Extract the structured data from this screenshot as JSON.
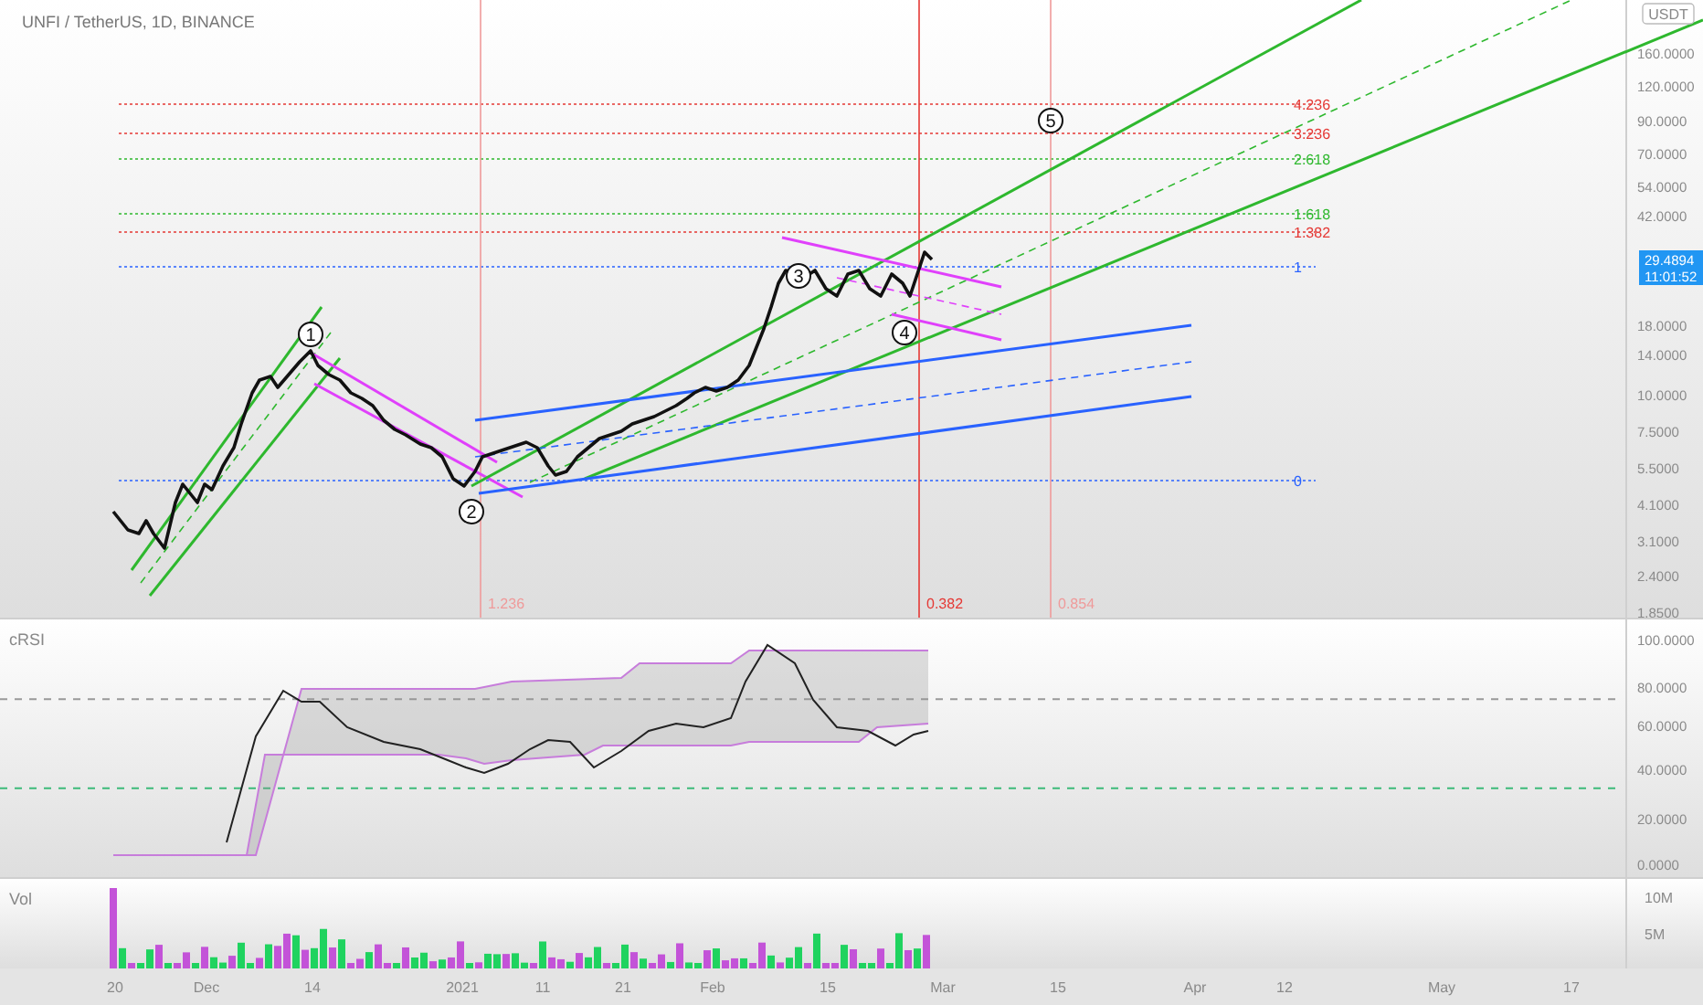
{
  "header": {
    "symbol": "UNFI / TetherUS, 1D, BINANCE"
  },
  "price_pane": {
    "fib_levels": [
      {
        "label": "4.236",
        "color": "#e53935"
      },
      {
        "label": "3.236",
        "color": "#e53935"
      },
      {
        "label": "2.618",
        "color": "#2eb82e"
      },
      {
        "label": "1.618",
        "color": "#2eb82e"
      },
      {
        "label": "1.382",
        "color": "#e53935"
      },
      {
        "label": "1",
        "color": "#2962ff"
      },
      {
        "label": "0",
        "color": "#2962ff"
      }
    ],
    "wave_labels": [
      "1",
      "2",
      "3",
      "4",
      "5"
    ],
    "time_fib_labels": [
      {
        "label": "1.236",
        "color": "#ef9a9a"
      },
      {
        "label": "0.382",
        "color": "#e53935"
      },
      {
        "label": "0.854",
        "color": "#ef9a9a"
      }
    ],
    "price_axis": {
      "currency": "USDT",
      "ticks": [
        "160.0000",
        "120.0000",
        "90.0000",
        "70.0000",
        "54.0000",
        "42.0000",
        "18.0000",
        "14.0000",
        "10.0000",
        "7.5000",
        "5.5000",
        "4.1000",
        "3.1000",
        "2.4000",
        "1.8500"
      ]
    },
    "last_price": {
      "price": "29.4894",
      "countdown": "11:01:52"
    }
  },
  "crsi_pane": {
    "title": "cRSI",
    "ticks": [
      "100.0000",
      "80.0000",
      "60.0000",
      "40.0000",
      "20.0000",
      "0.0000"
    ]
  },
  "volume_pane": {
    "title": "Vol",
    "ticks": [
      "10M",
      "5M"
    ]
  },
  "time_axis": {
    "ticks": [
      "20",
      "Dec",
      "14",
      "2021",
      "11",
      "21",
      "Feb",
      "15",
      "Mar",
      "15",
      "Apr",
      "12",
      "May",
      "17"
    ]
  }
}
